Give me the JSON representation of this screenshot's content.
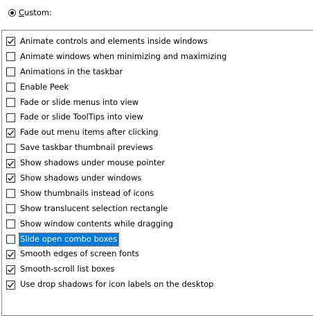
{
  "custom_option": {
    "label_first": "C",
    "label_rest": "ustom:",
    "selected": true
  },
  "effects": [
    {
      "label": "Animate controls and elements inside windows",
      "checked": true
    },
    {
      "label": "Animate windows when minimizing and maximizing",
      "checked": false
    },
    {
      "label": "Animations in the taskbar",
      "checked": false
    },
    {
      "label": "Enable Peek",
      "checked": false
    },
    {
      "label": "Fade or slide menus into view",
      "checked": false
    },
    {
      "label": "Fade or slide ToolTips into view",
      "checked": false
    },
    {
      "label": "Fade out menu items after clicking",
      "checked": true
    },
    {
      "label": "Save taskbar thumbnail previews",
      "checked": false
    },
    {
      "label": "Show shadows under mouse pointer",
      "checked": true
    },
    {
      "label": "Show shadows under windows",
      "checked": true
    },
    {
      "label": "Show thumbnails instead of icons",
      "checked": false
    },
    {
      "label": "Show translucent selection rectangle",
      "checked": false
    },
    {
      "label": "Show window contents while dragging",
      "checked": false
    },
    {
      "label": "Slide open combo boxes",
      "checked": false,
      "selected": true
    },
    {
      "label": "Smooth edges of screen fonts",
      "checked": true
    },
    {
      "label": "Smooth-scroll list boxes",
      "checked": true
    },
    {
      "label": "Use drop shadows for icon labels on the desktop",
      "checked": true
    }
  ],
  "colors": {
    "selection": "#0078d7",
    "border": "#828790"
  }
}
